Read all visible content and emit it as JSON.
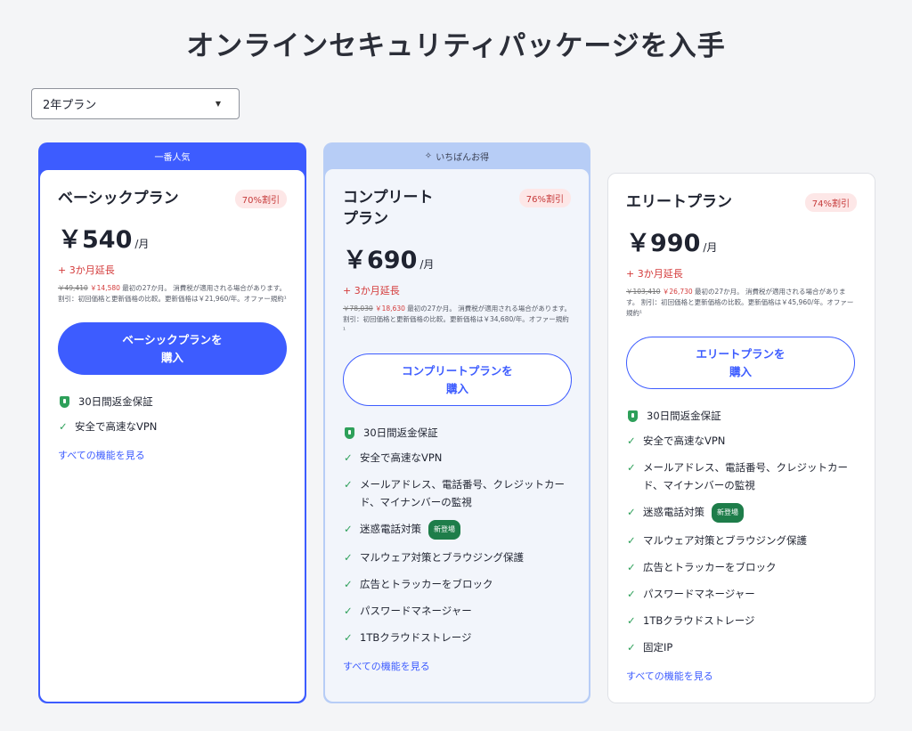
{
  "page": {
    "title": "オンラインセキュリティパッケージを入手"
  },
  "plan_select": {
    "value": "2年プラン"
  },
  "cards": [
    {
      "band": "一番人気",
      "name_line1": "ベーシックプラン",
      "name_line2": "",
      "discount": "70%割引",
      "price": "￥540",
      "unit": "/月",
      "extension": "+ 3か月延長",
      "old_price": "￥49,410",
      "new_price": "￥14,580",
      "fine_print": "最初の27か月。 消費税が適用される場合があります。 割引：初回価格と更新価格の比較。更新価格は￥21,960/年。オファー規約¹",
      "button_line1": "ベーシックプランを",
      "button_line2": "購入",
      "guarantee": "30日間返金保証",
      "features": [
        {
          "text": "安全で高速なVPN",
          "badge": ""
        }
      ],
      "link": "すべての機能を見る"
    },
    {
      "band": "いちばんお得",
      "name_line1": "コンプリート",
      "name_line2": "プラン",
      "discount": "76%割引",
      "price": "￥690",
      "unit": "/月",
      "extension": "+ 3か月延長",
      "old_price": "￥78,030",
      "new_price": "￥18,630",
      "fine_print": "最初の27か月。 消費税が適用される場合があります。 割引：初回価格と更新価格の比較。更新価格は￥34,680/年。オファー規約¹",
      "button_line1": "コンプリートプランを",
      "button_line2": "購入",
      "guarantee": "30日間返金保証",
      "features": [
        {
          "text": "安全で高速なVPN",
          "badge": ""
        },
        {
          "text": "メールアドレス、電話番号、クレジットカード、マイナンバーの監視",
          "badge": ""
        },
        {
          "text": "迷惑電話対策",
          "badge": "新登場"
        },
        {
          "text": "マルウェア対策とブラウジング保護",
          "badge": ""
        },
        {
          "text": "広告とトラッカーをブロック",
          "badge": ""
        },
        {
          "text": "パスワードマネージャー",
          "badge": ""
        },
        {
          "text": "1TBクラウドストレージ",
          "badge": ""
        }
      ],
      "link": "すべての機能を見る"
    },
    {
      "band": "",
      "name_line1": "エリートプラン",
      "name_line2": "",
      "discount": "74%割引",
      "price": "￥990",
      "unit": "/月",
      "extension": "+ 3か月延長",
      "old_price": "￥103,410",
      "new_price": "￥26,730",
      "fine_print": "最初の27か月。 消費税が適用される場合があります。 割引：初回価格と更新価格の比較。更新価格は￥45,960/年。オファー規約¹",
      "button_line1": "エリートプランを",
      "button_line2": "購入",
      "guarantee": "30日間返金保証",
      "features": [
        {
          "text": "安全で高速なVPN",
          "badge": ""
        },
        {
          "text": "メールアドレス、電話番号、クレジットカード、マイナンバーの監視",
          "badge": ""
        },
        {
          "text": "迷惑電話対策",
          "badge": "新登場"
        },
        {
          "text": "マルウェア対策とブラウジング保護",
          "badge": ""
        },
        {
          "text": "広告とトラッカーをブロック",
          "badge": ""
        },
        {
          "text": "パスワードマネージャー",
          "badge": ""
        },
        {
          "text": "1TBクラウドストレージ",
          "badge": ""
        },
        {
          "text": "固定IP",
          "badge": ""
        }
      ],
      "link": "すべての機能を見る"
    }
  ]
}
